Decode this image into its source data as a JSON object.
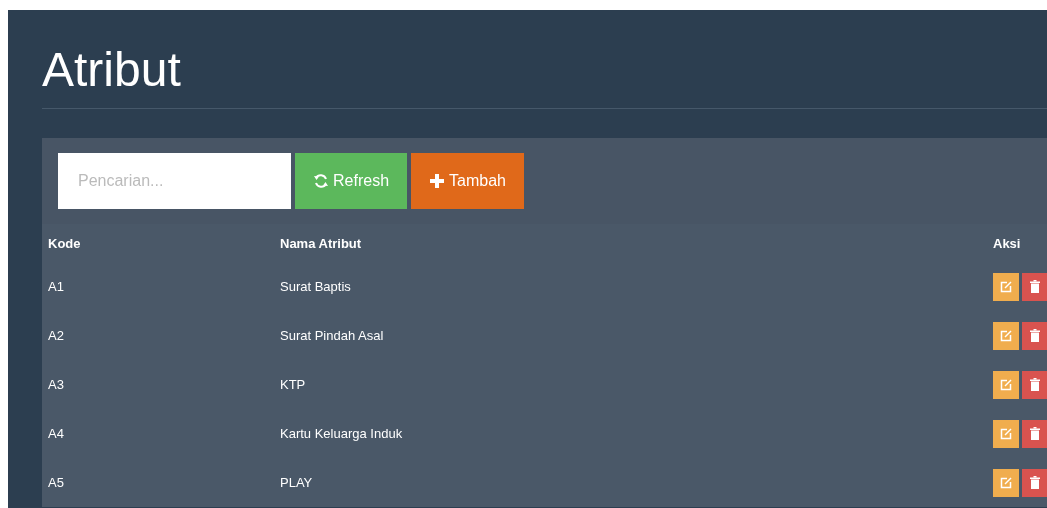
{
  "page": {
    "title": "Atribut"
  },
  "toolbar": {
    "search": {
      "placeholder": "Pencarian..."
    },
    "buttons": [
      {
        "kind": "refresh",
        "label": "Refresh"
      },
      {
        "kind": "add",
        "label": "Tambah"
      }
    ]
  },
  "table": {
    "columns": [
      "Kode",
      "Nama Atribut",
      "Aksi"
    ],
    "rows": [
      {
        "code": "A1",
        "name": "Surat Baptis"
      },
      {
        "code": "A2",
        "name": "Surat Pindah Asal"
      },
      {
        "code": "A3",
        "name": "KTP"
      },
      {
        "code": "A4",
        "name": "Kartu Keluarga Induk"
      },
      {
        "code": "A5",
        "name": "PLAY"
      }
    ]
  }
}
